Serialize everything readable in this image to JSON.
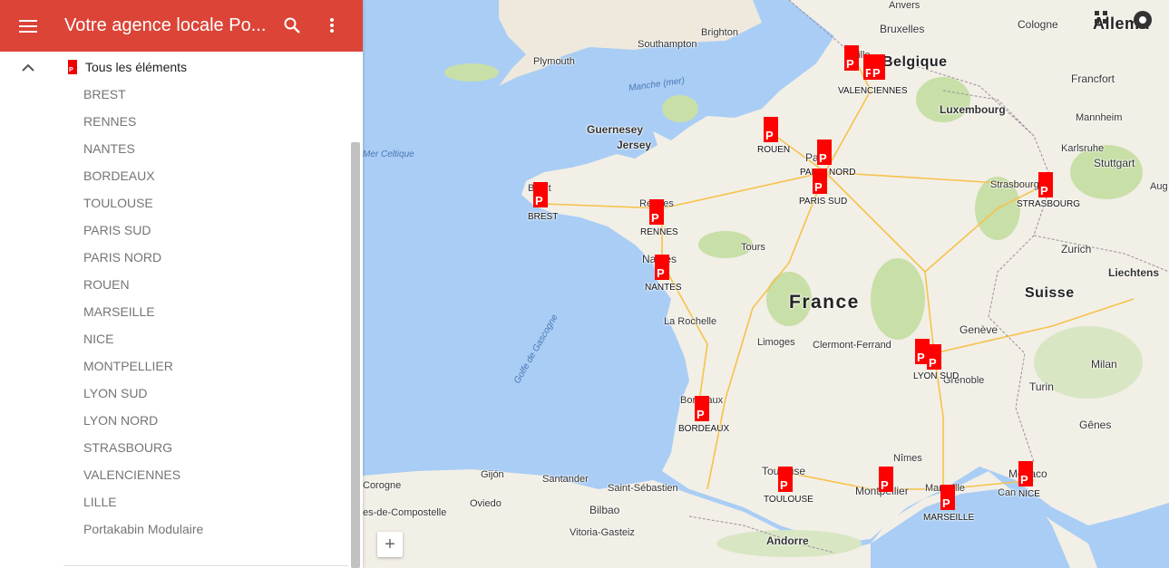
{
  "header": {
    "title": "Votre agence locale Po..."
  },
  "layer": {
    "marker_glyph": "P",
    "label": "Tous les éléments"
  },
  "items": [
    "BREST",
    "RENNES",
    "NANTES",
    "BORDEAUX",
    "TOULOUSE",
    "PARIS SUD",
    "PARIS NORD",
    "ROUEN",
    "MARSEILLE",
    "NICE",
    "MONTPELLIER",
    "LYON SUD",
    "LYON NORD",
    "STRASBOURG",
    "VALENCIENNES",
    "LILLE",
    "Portakabin Modulaire"
  ],
  "colors": {
    "header": "#db4437",
    "marker": "#ff0000",
    "sea": "#a9cdf5",
    "land": "#f2efe6",
    "forest": "#c8dfa8"
  },
  "icons": {
    "menu": "menu-icon",
    "search": "search-icon",
    "more": "more-vert-icon",
    "collapse": "chevron-up-icon",
    "zoom": "plus-icon"
  },
  "map": {
    "pin_glyph": "P",
    "zoom_in": "+",
    "labels": {
      "anvers": "Anvers",
      "bruxelles": "Bruxelles",
      "belgique": "Belgique",
      "cologne": "Cologne",
      "allemagne": "Allema",
      "brighton": "Brighton",
      "southampton": "Southampton",
      "plymouth": "Plymouth",
      "manche": "Manche (mer)",
      "guernesey": "Guernesey",
      "jersey": "Jersey",
      "mer_celtique": "Mer Celtique",
      "luxembourg": "Luxembourg",
      "francfort": "Francfort",
      "mannheim": "Mannheim",
      "karlsruhe": "Karlsruhe",
      "stuttgart": "Stuttgart",
      "augsb": "Aug",
      "strasbourg_city": "Strasbourg",
      "zurich": "Zurich",
      "liechtenstein": "Liechtens",
      "suisse": "Suisse",
      "geneve": "Genève",
      "milan": "Milan",
      "turin": "Turin",
      "genes": "Gênes",
      "monaco": "Monaco",
      "cannes": "Can",
      "france": "France",
      "tours": "Tours",
      "la_rochelle": "La Rochelle",
      "limoges": "Limoges",
      "clermont": "Clermont-Ferrand",
      "grenoble": "Grenoble",
      "nimes": "Nîmes",
      "andorre": "Andorre",
      "golfe": "Golfe de Gascogne",
      "gijon": "Gijón",
      "santander": "Santander",
      "st_sebastien": "Saint-Sébastien",
      "bilbao": "Bilbao",
      "vitoria": "Vitoria-Gasteiz",
      "corogne": "Corogne",
      "oviedo": "Oviedo",
      "compostelle": "es-de-Compostelle",
      "brest_city": "Brest",
      "rennes_city": "Rennes",
      "nantes_city": "Nantes",
      "paris_city": "Paris",
      "bordeaux_city": "Bordeaux",
      "toulouse_city": "Toulouse",
      "montpellier_city": "Montpellier",
      "marseille_city": "Marseille",
      "lille_city": "Lille"
    },
    "agencies": {
      "brest": "BREST",
      "rennes": "RENNES",
      "nantes": "NANTES",
      "rouen": "ROUEN",
      "paris_nord": "PARIS NORD",
      "paris_sud": "PARIS SUD",
      "valenciennes": "VALENCIENNES",
      "strasbourg": "STRASBOURG",
      "lyon_sud": "LYON SUD",
      "bordeaux": "BORDEAUX",
      "toulouse": "TOULOUSE",
      "marseille": "MARSEILLE",
      "nice": "NICE"
    }
  }
}
